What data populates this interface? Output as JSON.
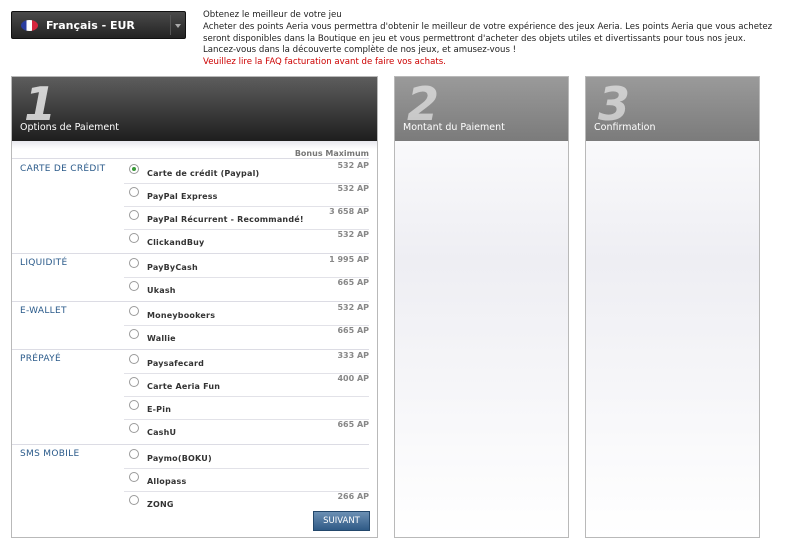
{
  "language_selector": {
    "label": "Français - EUR",
    "icon": "flag-france-icon"
  },
  "intro": {
    "title": "Obtenez le meilleur de votre jeu",
    "line1": "Acheter des points Aeria vous permettra d'obtenir le meilleur de votre expérience des jeux Aeria. Les points Aeria que vous achetez",
    "line2": "seront disponibles dans la Boutique en jeu et vous permettront d'acheter des objets utiles et divertissants pour tous nos jeux.",
    "line3": "Lancez-vous dans la découverte complète de nos jeux, et amusez-vous !",
    "notice_pre": "Veuillez lire la",
    "notice_link": "FAQ facturation",
    "notice_post": "avant de faire vos achats."
  },
  "steps": [
    {
      "number": "1",
      "label": "Options de Paiement"
    },
    {
      "number": "2",
      "label": "Montant du Paiement"
    },
    {
      "number": "3",
      "label": "Confirmation"
    }
  ],
  "payment": {
    "bonus_header": "Bonus Maximum",
    "categories": [
      {
        "name": "CARTE DE CRÉDIT"
      },
      {
        "name": "LIQUIDITÉ"
      },
      {
        "name": "E-WALLET"
      },
      {
        "name": "PRÉPAYÉ"
      },
      {
        "name": "SMS MOBILE"
      }
    ],
    "methods": [
      {
        "name": "Carte de crédit (Paypal)",
        "bonus": "532 AP",
        "selected": true
      },
      {
        "name": "PayPal Express",
        "bonus": "532 AP"
      },
      {
        "name": "PayPal Récurrent - Recommandé!",
        "bonus": "3 658 AP"
      },
      {
        "name": "ClickandBuy",
        "bonus": "532 AP"
      },
      {
        "name": "PayByCash",
        "bonus": "1 995 AP"
      },
      {
        "name": "Ukash",
        "bonus": "665 AP"
      },
      {
        "name": "Moneybookers",
        "bonus": "532 AP"
      },
      {
        "name": "Wallie",
        "bonus": "665 AP"
      },
      {
        "name": "Paysafecard",
        "bonus": "333 AP"
      },
      {
        "name": "Carte Aeria Fun",
        "bonus": "400 AP"
      },
      {
        "name": "E-Pin",
        "bonus": ""
      },
      {
        "name": "CashU",
        "bonus": "665 AP"
      },
      {
        "name": "Paymo(BOKU)",
        "bonus": ""
      },
      {
        "name": "Allopass",
        "bonus": ""
      },
      {
        "name": "ZONG",
        "bonus": "266 AP"
      }
    ],
    "next_button": "SUIVANT"
  },
  "colors": {
    "category_blue": "#2a5a8a",
    "notice_red": "#cc0000",
    "button_blue": "#2f5a86"
  }
}
